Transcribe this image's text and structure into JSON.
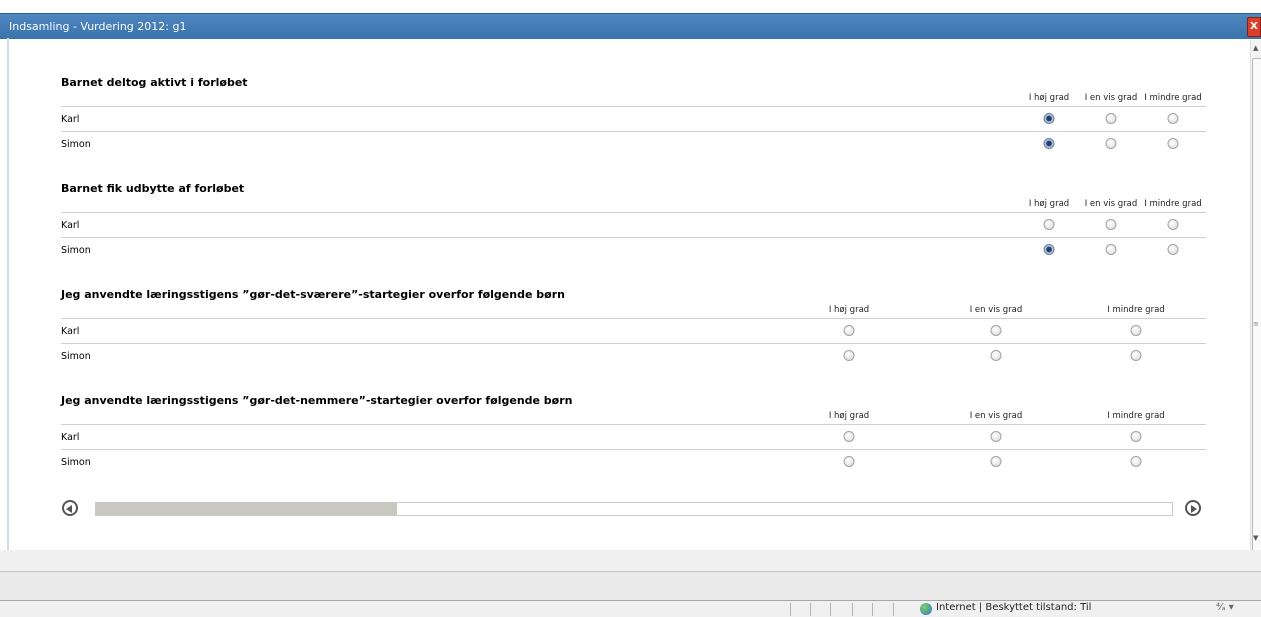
{
  "window": {
    "title": "Indsamling - Vurdering 2012: g1",
    "close_label": "X"
  },
  "columns": [
    "I høj grad",
    "I en vis grad",
    "I mindre grad"
  ],
  "sections": [
    {
      "title": "Barnet deltog aktivt i forløbet",
      "rows": [
        {
          "name": "Karl",
          "selected": 0
        },
        {
          "name": "Simon",
          "selected": 0
        }
      ]
    },
    {
      "title": "Barnet fik udbytte af forløbet",
      "rows": [
        {
          "name": "Karl",
          "selected": null
        },
        {
          "name": "Simon",
          "selected": 0
        }
      ]
    },
    {
      "title": "Jeg anvendte læringsstigens ”gør-det-sværere”-startegier overfor følgende børn",
      "rows": [
        {
          "name": "Karl",
          "selected": null
        },
        {
          "name": "Simon",
          "selected": null
        }
      ]
    },
    {
      "title": "Jeg anvendte læringsstigens ”gør-det-nemmere”-startegier overfor følgende børn",
      "rows": [
        {
          "name": "Karl",
          "selected": null
        },
        {
          "name": "Simon",
          "selected": null
        }
      ]
    }
  ],
  "progress": {
    "fraction": 0.28
  },
  "status": {
    "zone_text": "Internet | Beskyttet tilstand: Til",
    "zoom_text": "⁴⁄ₐ ▾"
  }
}
